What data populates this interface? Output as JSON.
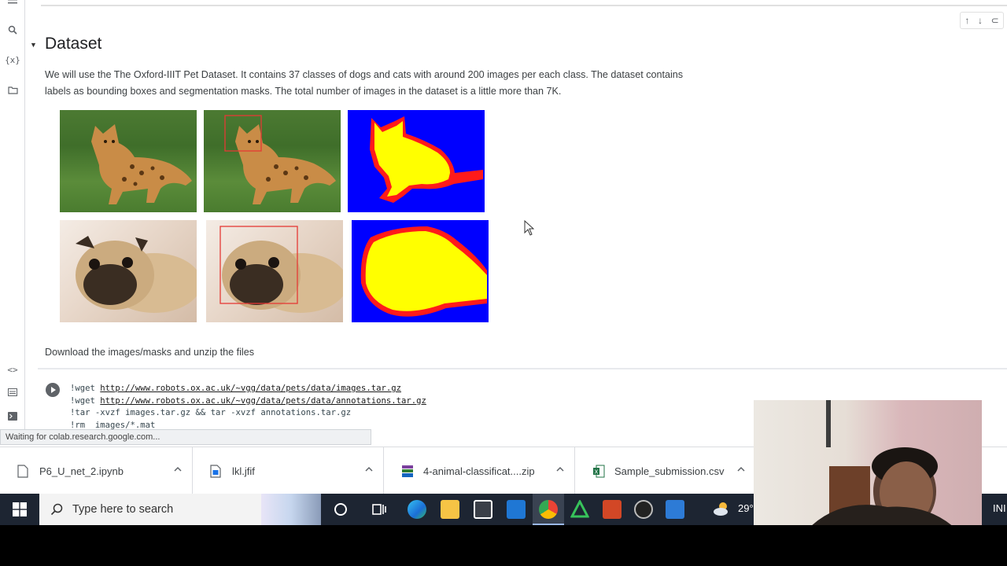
{
  "section": {
    "title": "Dataset",
    "description": "We will use the The Oxford-IIIT Pet Dataset. It contains 37 classes of dogs and cats with around 200 images per each class. The dataset contains labels as bounding boxes and segmentation masks. The total number of images in the dataset is a little more than 7K.",
    "footer": "Download the images/masks and unzip the files"
  },
  "code": {
    "line1_cmd": "!wget ",
    "line1_url": "http://www.robots.ox.ac.uk/~vgg/data/pets/data/images.tar.gz",
    "line2_cmd": "!wget ",
    "line2_url": "http://www.robots.ox.ac.uk/~vgg/data/pets/data/annotations.tar.gz",
    "line3": "!tar -xvzf images.tar.gz && tar -xvzf annotations.tar.gz",
    "line4": "!rm  images/*.mat"
  },
  "status_text": "Waiting for colab.research.google.com...",
  "downloads": [
    {
      "name": "P6_U_net_2.ipynb",
      "icon": "file-icon"
    },
    {
      "name": "lkl.jfif",
      "icon": "image-file-icon"
    },
    {
      "name": "4-animal-classificat....zip",
      "icon": "zip-archive-icon"
    },
    {
      "name": "Sample_submission.csv",
      "icon": "excel-csv-icon"
    }
  ],
  "taskbar": {
    "search_placeholder": "Type here to search",
    "weather_temp": "29°",
    "tray_lang": "INI"
  },
  "colors": {
    "mask_blue": "#0000ff",
    "mask_yellow": "#ffff00",
    "mask_red": "#ff1a1a",
    "bbox_red": "#e53935",
    "taskbar": "#1d2532"
  }
}
